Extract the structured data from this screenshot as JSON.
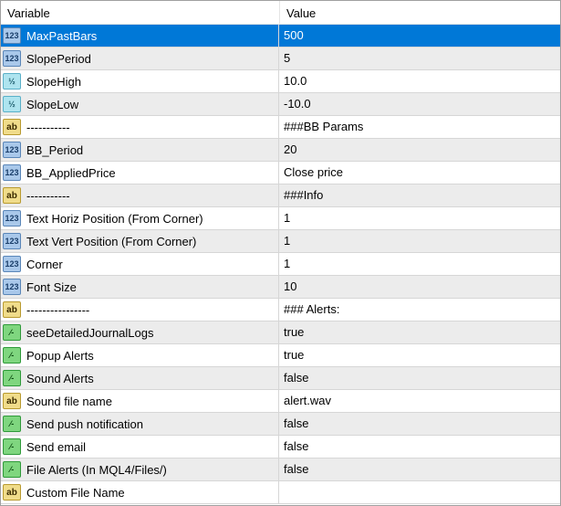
{
  "header": {
    "variable": "Variable",
    "value": "Value"
  },
  "rows": [
    {
      "name": "MaxPastBars",
      "value": "500",
      "type": "int"
    },
    {
      "name": "SlopePeriod",
      "value": "5",
      "type": "int"
    },
    {
      "name": "SlopeHigh",
      "value": "10.0",
      "type": "dbl"
    },
    {
      "name": "SlopeLow",
      "value": "-10.0",
      "type": "dbl"
    },
    {
      "name": "-----------",
      "value": "###BB Params",
      "type": "str"
    },
    {
      "name": "BB_Period",
      "value": "20",
      "type": "int"
    },
    {
      "name": "BB_AppliedPrice",
      "value": "Close price",
      "type": "int"
    },
    {
      "name": "-----------",
      "value": "###Info",
      "type": "str"
    },
    {
      "name": "Text Horiz Position (From Corner)",
      "value": "1",
      "type": "int"
    },
    {
      "name": "Text Vert Position (From Corner)",
      "value": "1",
      "type": "int"
    },
    {
      "name": "Corner",
      "value": "1",
      "type": "int"
    },
    {
      "name": "Font Size",
      "value": "10",
      "type": "int"
    },
    {
      "name": "----------------",
      "value": "### Alerts:",
      "type": "str"
    },
    {
      "name": "seeDetailedJournalLogs",
      "value": "true",
      "type": "bool"
    },
    {
      "name": "Popup Alerts",
      "value": "true",
      "type": "bool"
    },
    {
      "name": "Sound Alerts",
      "value": "false",
      "type": "bool"
    },
    {
      "name": "Sound file name",
      "value": "alert.wav",
      "type": "str"
    },
    {
      "name": "Send push notification",
      "value": "false",
      "type": "bool"
    },
    {
      "name": "Send email",
      "value": "false",
      "type": "bool"
    },
    {
      "name": "File Alerts (In MQL4/Files/)",
      "value": "false",
      "type": "bool"
    },
    {
      "name": "Custom File Name",
      "value": "",
      "type": "str"
    }
  ],
  "icons": {
    "int": "123",
    "dbl": "½",
    "str": "ab",
    "bool": "⁄-"
  },
  "selected_index": 0
}
